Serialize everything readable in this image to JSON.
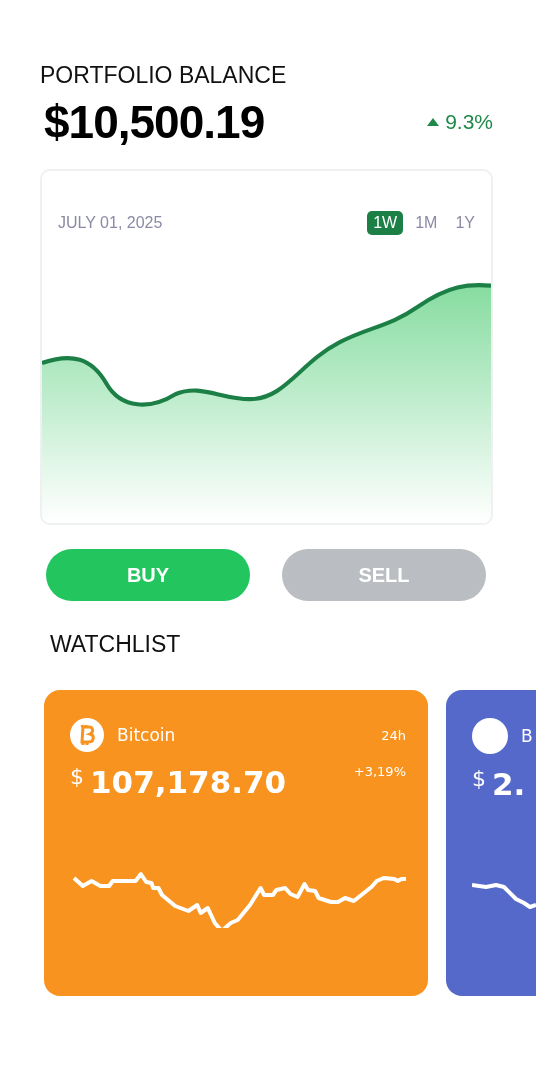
{
  "header": {
    "title": "PORTFOLIO BALANCE",
    "balance": "$10,500.19",
    "change": "9.3%"
  },
  "chart_card": {
    "date": "JULY 01, 2025",
    "ranges": [
      {
        "label": "1W",
        "selected": true
      },
      {
        "label": "1M",
        "selected": false
      },
      {
        "label": "1Y",
        "selected": false
      }
    ]
  },
  "actions": [
    {
      "label": "BUY",
      "kind": "buy"
    },
    {
      "label": "SELL",
      "kind": "sell"
    }
  ],
  "watchlist": {
    "title": "WATCHLIST",
    "cards": [
      {
        "name": "Bitcoin",
        "currency": "$",
        "price": "107,178.70",
        "period": "24h",
        "change": "+3,19%",
        "color": "#f7931e",
        "kind": "bitcoin"
      },
      {
        "name": "B",
        "currency": "$",
        "price": "2.",
        "color": "#5469c9",
        "kind": "plain"
      }
    ]
  }
}
